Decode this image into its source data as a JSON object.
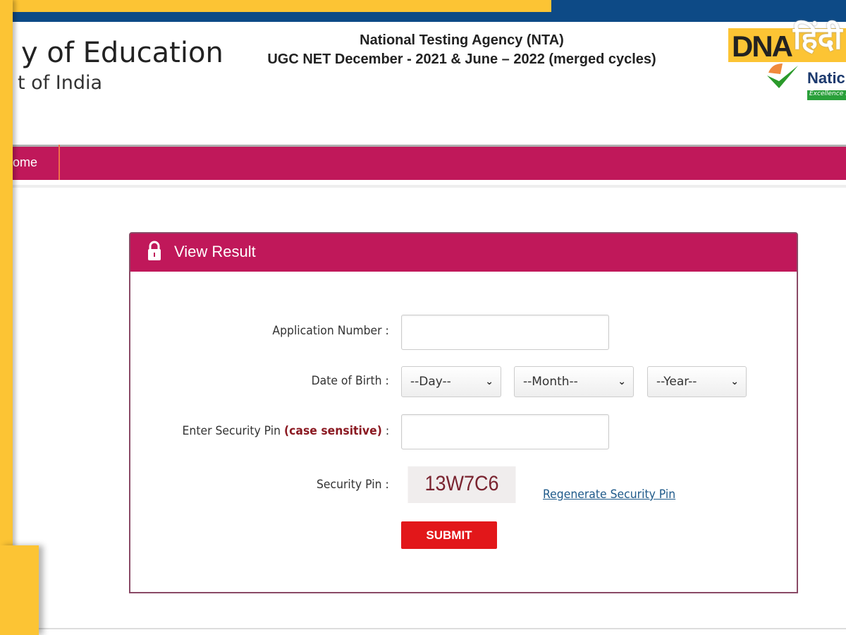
{
  "header": {
    "ministry_line1": "y of Education",
    "ministry_line2": "t of India",
    "agency": "National Testing Agency (NTA)",
    "exam": "UGC NET December - 2021 & June – 2022 (merged cycles)",
    "logo_right_text": "Natic",
    "logo_right_tagline": "Excellence i"
  },
  "watermark": {
    "brand": "DNA",
    "hindi": "हिंदी"
  },
  "nav": {
    "items": [
      {
        "label": "ome"
      }
    ]
  },
  "panel": {
    "title": "View Result",
    "icon": "lock-icon",
    "fields": {
      "application_number": {
        "label": "Application Number :",
        "value": ""
      },
      "dob": {
        "label": "Date of Birth :",
        "day": "--Day--",
        "month": "--Month--",
        "year": "--Year--"
      },
      "security_pin_input": {
        "label": "Enter Security Pin",
        "label_emphasis": "(case sensitive)",
        "colon": ":",
        "value": ""
      },
      "security_pin": {
        "label": "Security Pin :",
        "captcha": "13W7C6",
        "regenerate": "Regenerate Security Pin"
      }
    },
    "submit": "SUBMIT"
  },
  "colors": {
    "brand": "#c0185a",
    "submit": "#e2171a",
    "frame": "#fcc434",
    "topbar": "#0d4a86"
  }
}
